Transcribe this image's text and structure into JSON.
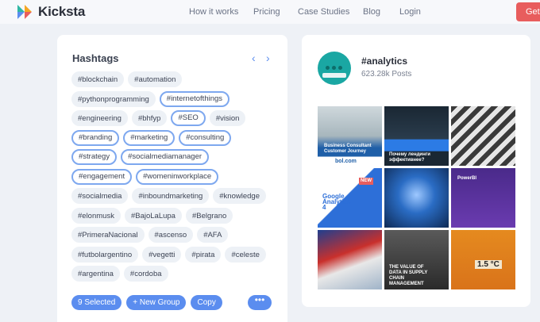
{
  "brand": {
    "name": "Kicksta"
  },
  "nav": {
    "links": [
      "How it works",
      "Pricing",
      "Case Studies",
      "Blog",
      "Login"
    ],
    "cta": "Get"
  },
  "hashtags": {
    "title": "Hashtags",
    "tags": [
      "#blockchain",
      "#automation",
      "#pythonprogramming",
      "#internetofthings",
      "#engineering",
      "#bhfyp",
      "#SEO",
      "#vision",
      "#branding",
      "#marketing",
      "#consulting",
      "#strategy",
      "#socialmediamanager",
      "#engagement",
      "#womeninworkplace",
      "#socialmedia",
      "#inboundmarketing",
      "#knowledge",
      "#elonmusk",
      "#BajoLaLupa",
      "#Belgrano",
      "#PrimeraNacional",
      "#ascenso",
      "#AFA",
      "#futbolargentino",
      "#vegetti",
      "#pirata",
      "#celeste",
      "#argentina",
      "#cordoba"
    ],
    "selected": [
      "#internetofthings",
      "#SEO",
      "#branding",
      "#marketing",
      "#consulting",
      "#strategy",
      "#socialmediamanager",
      "#engagement",
      "#womeninworkplace"
    ],
    "actions": {
      "selected_label": "9 Selected",
      "new_group": "+ New Group",
      "copy": "Copy",
      "more": "•••"
    }
  },
  "analytics": {
    "name": "#analytics",
    "posts": "623.28k Posts",
    "tiles": [
      {
        "caption": "Business Consultant Customer Journey",
        "brand": "bol.com"
      },
      {
        "caption": "Почему лендинги эффективнее?"
      },
      {
        "caption": ""
      },
      {
        "caption": "Google Analytics 4",
        "badge": "NEW"
      },
      {
        "caption": ""
      },
      {
        "caption": "PowerBI"
      },
      {
        "caption": ""
      },
      {
        "caption": "THE VALUE OF DATA IN SUPPLY CHAIN MANAGEMENT"
      },
      {
        "caption": "1.5 °C"
      }
    ]
  }
}
